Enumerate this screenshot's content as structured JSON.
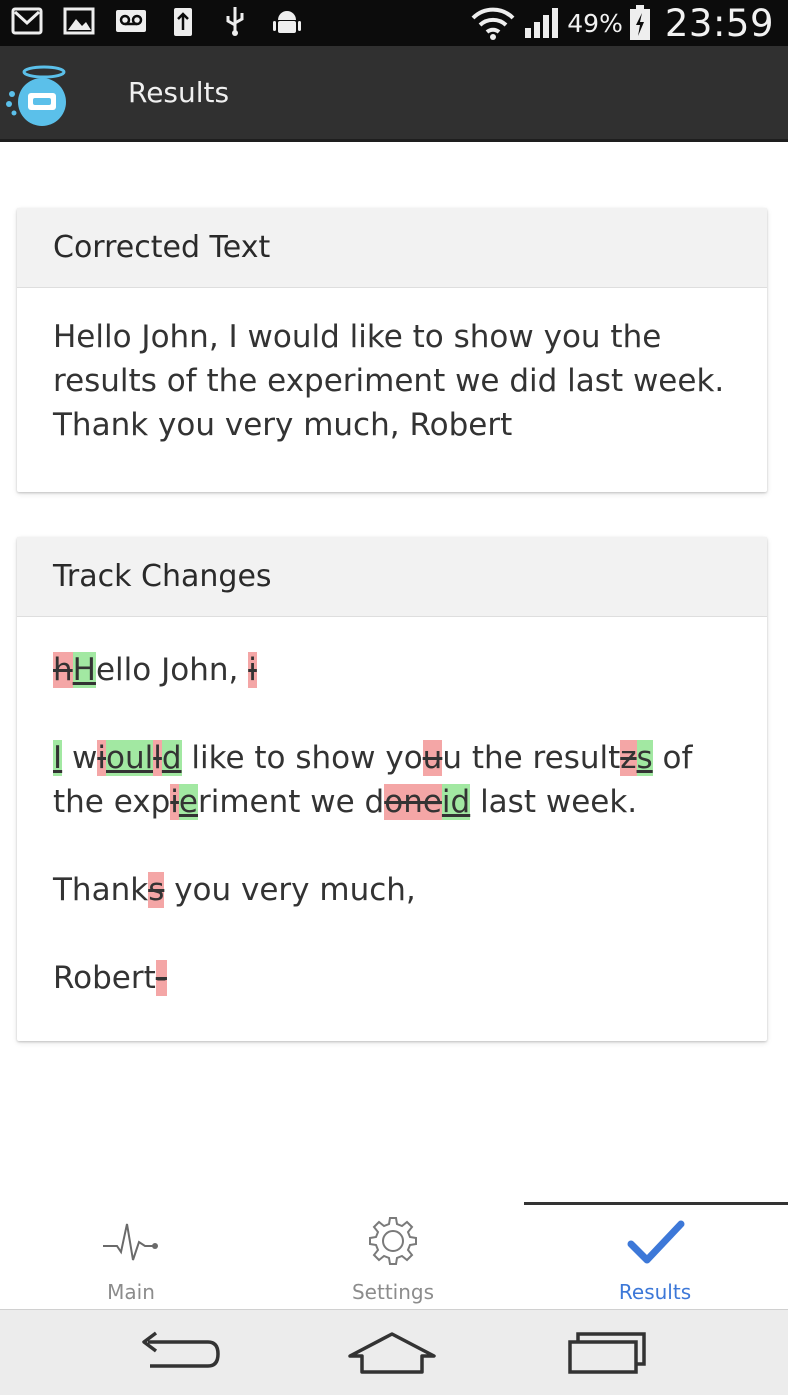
{
  "status_bar": {
    "battery_percent": "49%",
    "time": "23:59",
    "icons": [
      "gmail-icon",
      "gallery-icon",
      "voicemail-icon",
      "usb-charge-icon",
      "usb-icon",
      "android-debug-icon",
      "wifi-icon",
      "signal-icon",
      "battery-icon"
    ]
  },
  "action_bar": {
    "title": "Results",
    "logo_icon": "app-logo-icon"
  },
  "corrected_card": {
    "title": "Corrected Text",
    "text": "Hello John, I would like to show you the results of the experiment we did last week. Thank you very much, Robert"
  },
  "track_card": {
    "title": "Track Changes",
    "paragraphs": [
      [
        {
          "t": "h",
          "type": "del"
        },
        {
          "t": "H",
          "type": "ins"
        },
        {
          "t": "ello John, ",
          "type": "eq"
        },
        {
          "t": "i",
          "type": "del"
        }
      ],
      [
        {
          "t": "I",
          "type": "ins"
        },
        {
          "t": " w",
          "type": "eq"
        },
        {
          "t": "i",
          "type": "del"
        },
        {
          "t": "oul",
          "type": "ins"
        },
        {
          "t": "l",
          "type": "del"
        },
        {
          "t": "d",
          "type": "ins"
        },
        {
          "t": " like to show yo",
          "type": "eq"
        },
        {
          "t": "u",
          "type": "del"
        },
        {
          "t": "u the result",
          "type": "eq"
        },
        {
          "t": "z",
          "type": "del"
        },
        {
          "t": "s",
          "type": "ins"
        },
        {
          "t": " of the exp",
          "type": "eq"
        },
        {
          "t": "i",
          "type": "del"
        },
        {
          "t": "e",
          "type": "ins"
        },
        {
          "t": "riment we d",
          "type": "eq"
        },
        {
          "t": "one",
          "type": "del"
        },
        {
          "t": "id",
          "type": "ins"
        },
        {
          "t": " last week.",
          "type": "eq"
        }
      ],
      [
        {
          "t": "Thank",
          "type": "eq"
        },
        {
          "t": "s",
          "type": "del"
        },
        {
          "t": " you very much,",
          "type": "eq"
        }
      ],
      [
        {
          "t": "Robert",
          "type": "eq"
        },
        {
          "t": "-",
          "type": "del"
        }
      ]
    ]
  },
  "tabs": [
    {
      "label": "Main",
      "icon": "heartbeat-icon",
      "active": false
    },
    {
      "label": "Settings",
      "icon": "gear-icon",
      "active": false
    },
    {
      "label": "Results",
      "icon": "checkmark-icon",
      "active": true
    }
  ],
  "colors": {
    "deleted_bg": "#f4a6a6",
    "inserted_bg": "#a2e8a2",
    "active_tab": "#3d78d8",
    "action_bar": "#303030"
  },
  "nav_bar": {
    "buttons": [
      "back-icon",
      "home-icon",
      "recent-apps-icon"
    ]
  }
}
